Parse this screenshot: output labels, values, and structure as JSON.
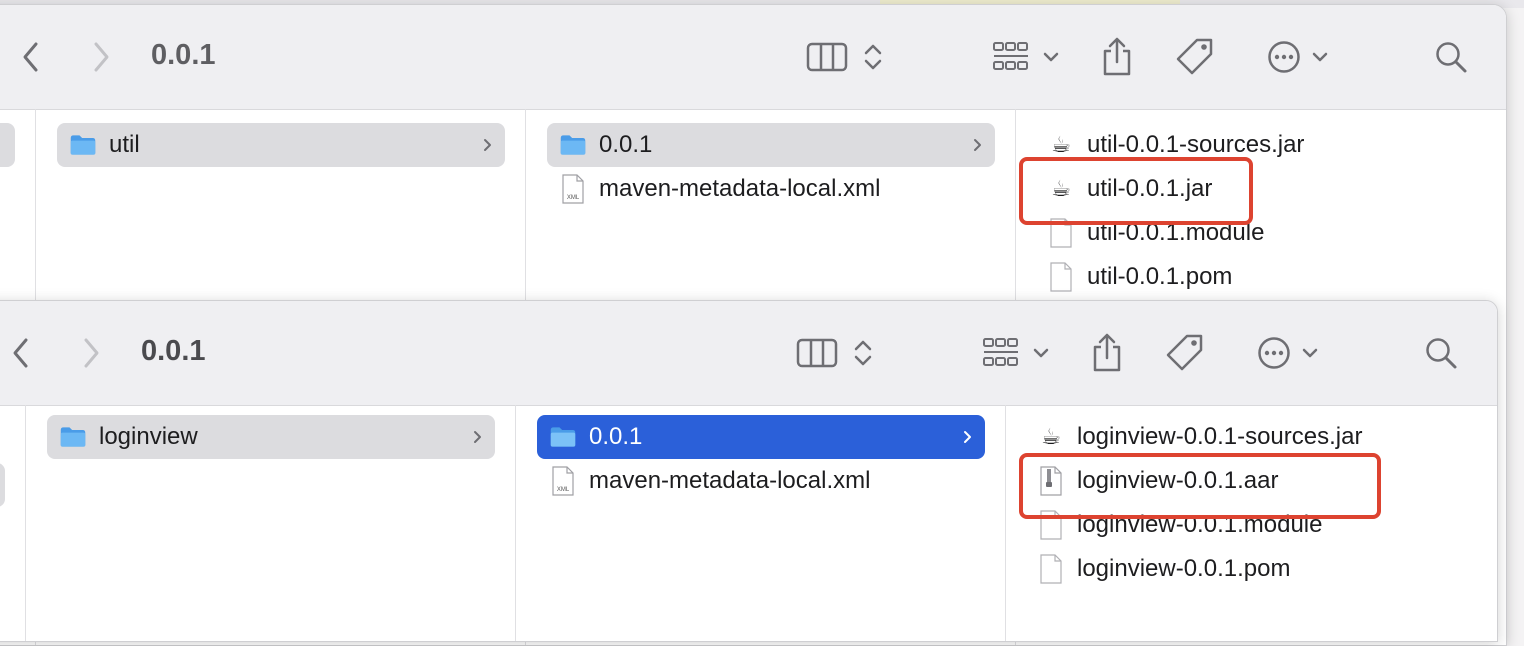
{
  "window1": {
    "title": "0.0.1",
    "column1": {
      "folder": "util"
    },
    "column2": {
      "folder": "0.0.1",
      "file": "maven-metadata-local.xml"
    },
    "column3": {
      "files": [
        "util-0.0.1-sources.jar",
        "util-0.0.1.jar",
        "util-0.0.1.module",
        "util-0.0.1.pom"
      ]
    }
  },
  "window2": {
    "title": "0.0.1",
    "column1": {
      "folder": "loginview"
    },
    "column2": {
      "folder": "0.0.1",
      "file": "maven-metadata-local.xml"
    },
    "column3": {
      "files": [
        "loginview-0.0.1-sources.jar",
        "loginview-0.0.1.aar",
        "loginview-0.0.1.module",
        "loginview-0.0.1.pom"
      ]
    }
  },
  "colors": {
    "accent": "#2b60d9",
    "highlight_box": "#dd4330",
    "folder": "#5aabef"
  },
  "icons": [
    "back-icon",
    "forward-icon",
    "column-view-icon",
    "group-icon",
    "share-icon",
    "tag-icon",
    "more-icon",
    "search-icon",
    "folder-icon",
    "java-coffee-icon",
    "zip-file-icon",
    "xml-file-icon",
    "document-icon"
  ]
}
